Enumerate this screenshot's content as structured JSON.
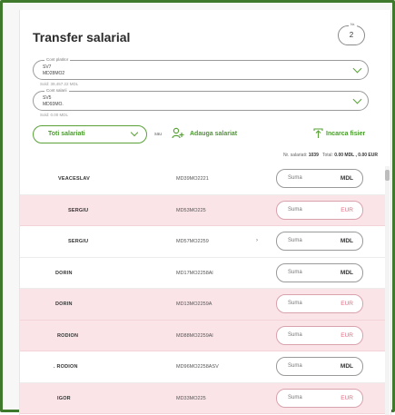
{
  "page": {
    "title": "Transfer salarial"
  },
  "nr": {
    "legend": "Nr.",
    "value": "2"
  },
  "cont_platitor": {
    "legend": "Cont platitor",
    "line1": "SV7",
    "line2": "MD28MO2",
    "sold": "Sold: 39,457.22 MDL"
  },
  "cont_salarii": {
    "legend": "Cont salarii",
    "line1": "SV5",
    "line2": "MD93MO.",
    "sold": "Sold: 0.00 MDL"
  },
  "filter": {
    "label": "Toti salariati",
    "sau": "sau"
  },
  "actions": {
    "add_label": "Adauga salariat",
    "upload_label": "Incarca fisier"
  },
  "summary": {
    "nr_label": "Nr. salariati:",
    "nr_value": "1039",
    "total_label": "Total:",
    "total_value": "0.00 MDL , 0.00 EUR"
  },
  "rows": [
    {
      "name": "VEACESLAV",
      "iban": "MD39MO2221",
      "placeholder": "Suma",
      "currency": "MDL"
    },
    {
      "name": "SERGIU",
      "iban": "MD53MO225",
      "placeholder": "Suma",
      "currency": "EUR"
    },
    {
      "name": "SERGIU",
      "iban": "MD57MO2259",
      "arrow": "›",
      "placeholder": "Suma",
      "currency": "MDL"
    },
    {
      "name": "DORIN",
      "iban": "MD17MO2258Al",
      "placeholder": "Suma",
      "currency": "MDL"
    },
    {
      "name": "DORIN",
      "iban": "MD13MO2259A",
      "placeholder": "Suma",
      "currency": "EUR"
    },
    {
      "name": "RODION",
      "iban": "MD88MO2259Al",
      "placeholder": "Suma",
      "currency": "EUR"
    },
    {
      "name": ". RODION",
      "iban": "MD96MO2258ASV",
      "placeholder": "Suma",
      "currency": "MDL"
    },
    {
      "name": "IGOR",
      "iban": "MD33MO225",
      "placeholder": "Suma",
      "currency": "EUR"
    }
  ],
  "colors": {
    "accent": "#4a9a2e",
    "frame": "#3f7a2c",
    "eur_row": "#fbe4e8",
    "eur_text": "#e06d82"
  },
  "icons": {
    "add": "add-user-icon",
    "upload": "upload-icon",
    "dropdown": "chevron-down-icon"
  }
}
